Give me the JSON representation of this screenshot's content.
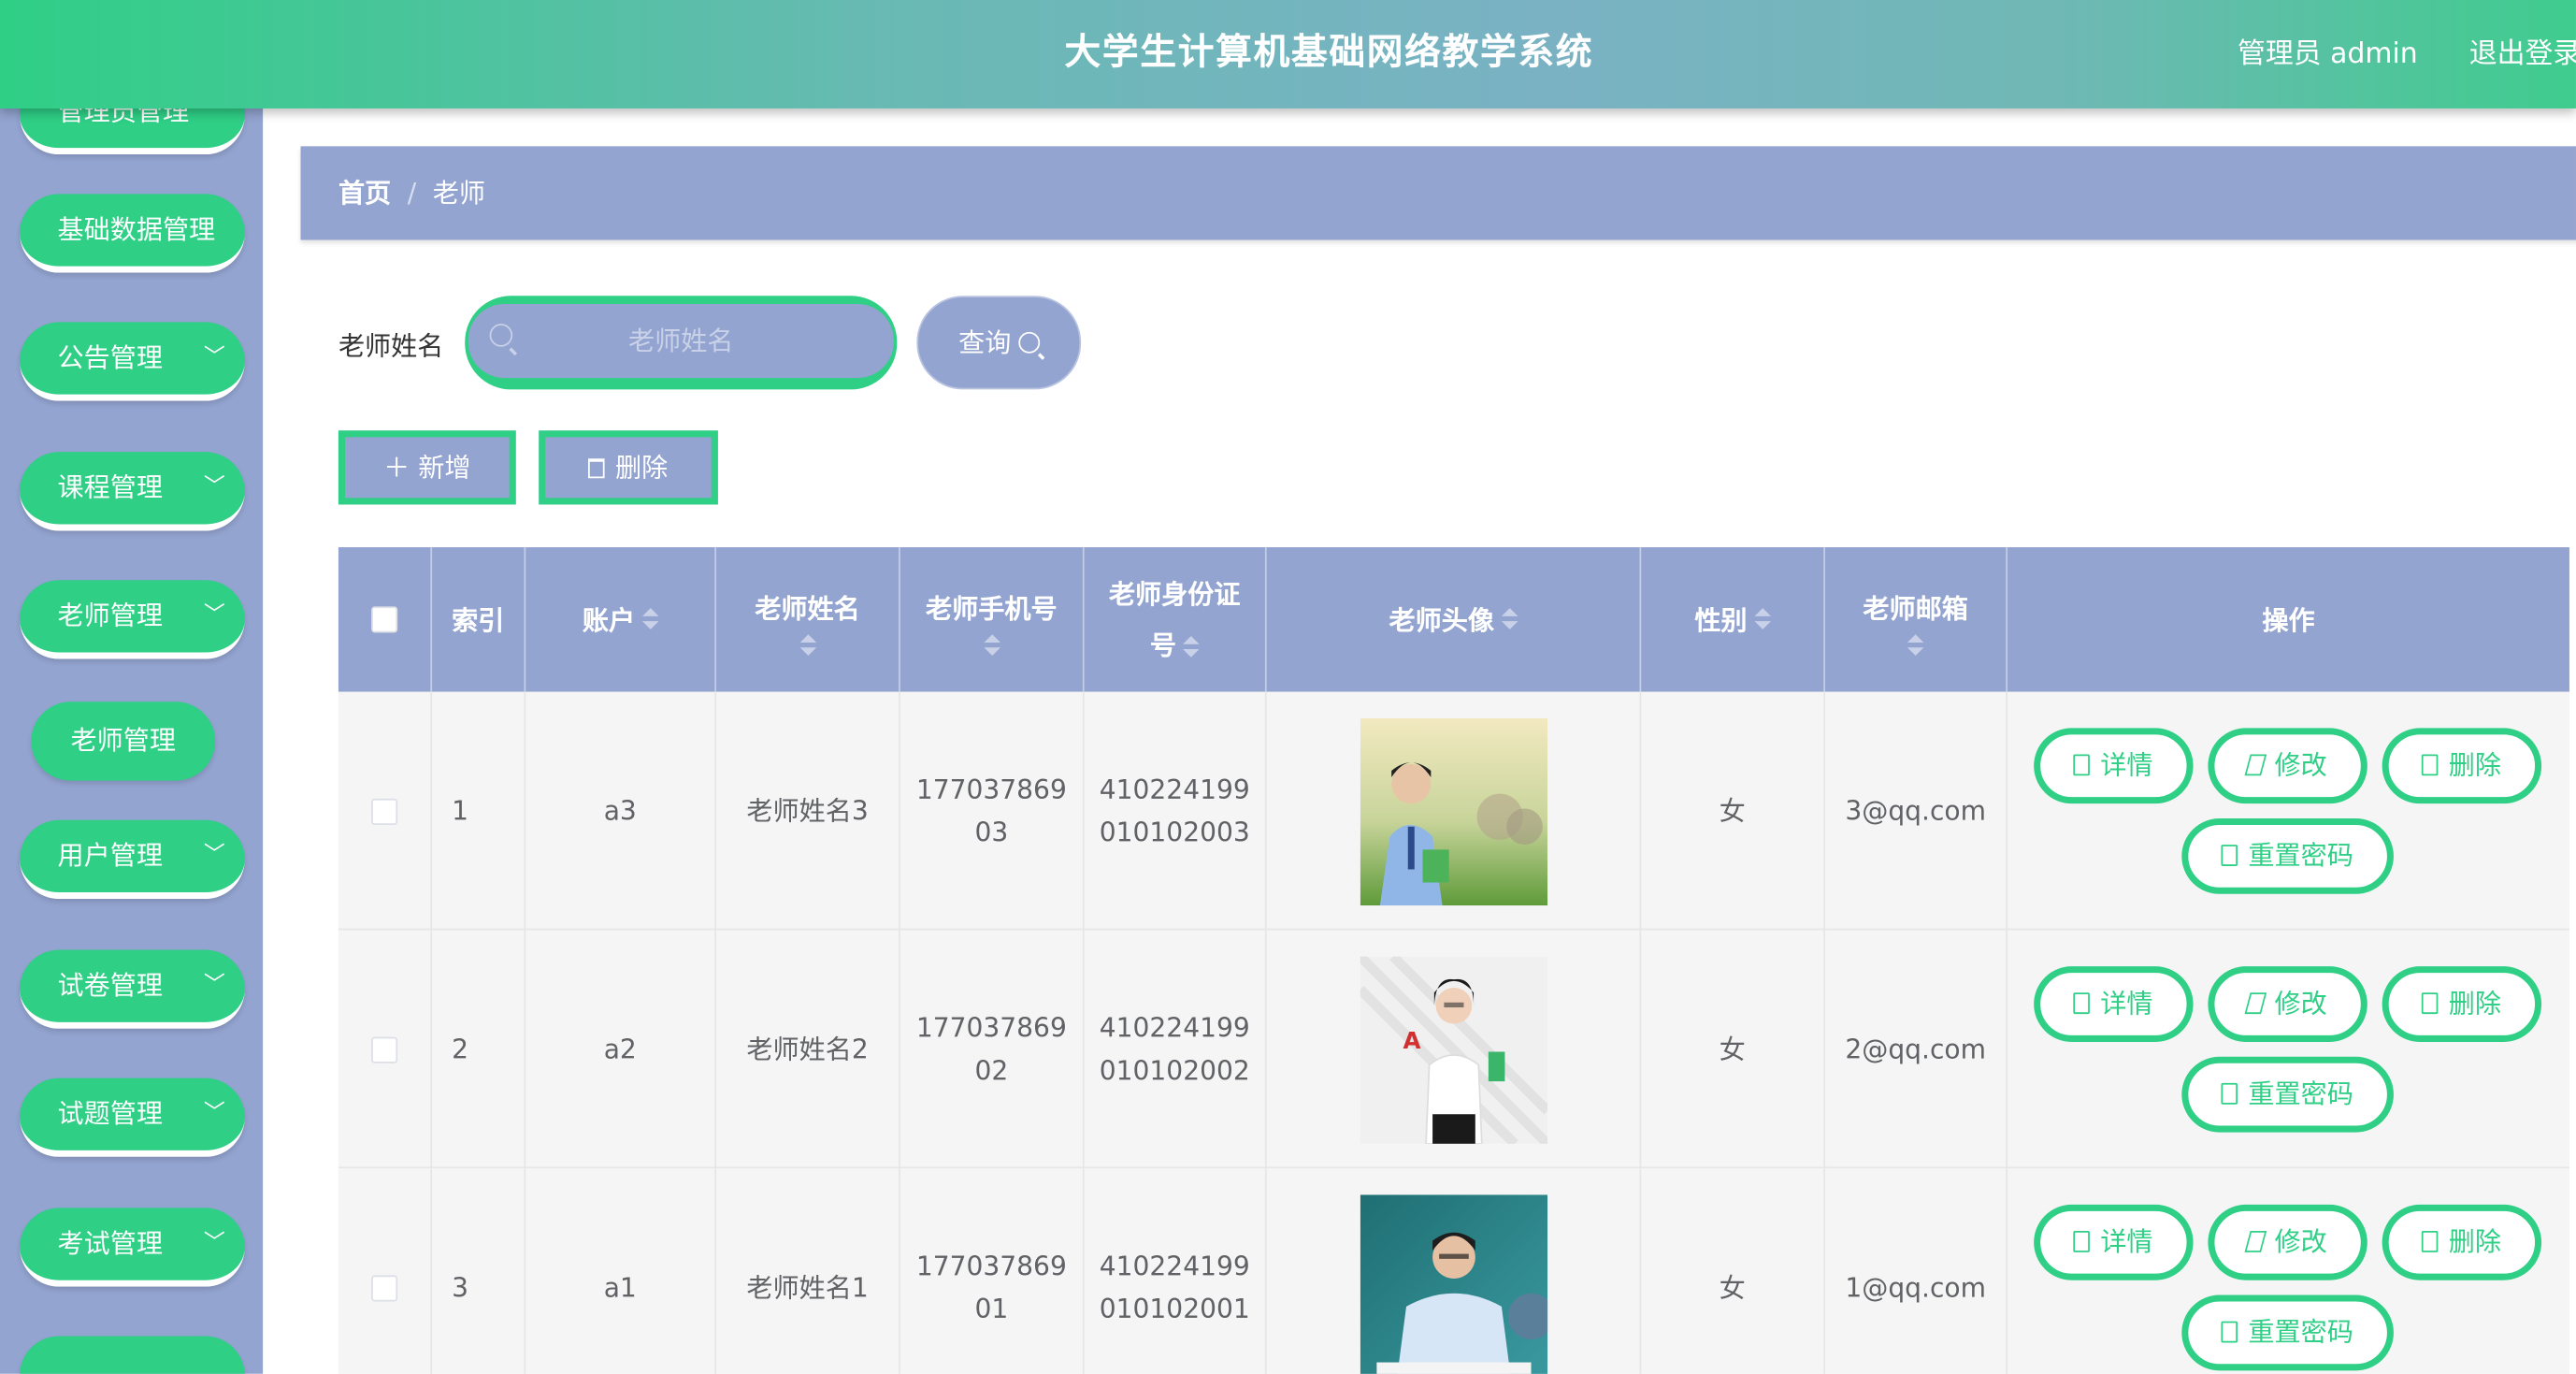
{
  "header": {
    "title": "大学生计算机基础网络教学系统",
    "admin": "管理员 admin",
    "logout": "退出登录"
  },
  "sidebar": {
    "items": [
      {
        "label": "管理员管理",
        "chevron": "﹀"
      },
      {
        "label": "基础数据管理",
        "chevron": ""
      },
      {
        "label": "公告管理",
        "chevron": "﹀"
      },
      {
        "label": "课程管理",
        "chevron": "﹀"
      },
      {
        "label": "老师管理",
        "chevron": "﹀"
      },
      {
        "label": "老师管理"
      },
      {
        "label": "用户管理",
        "chevron": "﹀"
      },
      {
        "label": "试卷管理",
        "chevron": "﹀"
      },
      {
        "label": "试题管理",
        "chevron": "﹀"
      },
      {
        "label": "考试管理",
        "chevron": "﹀"
      }
    ]
  },
  "breadcrumb": {
    "home": "首页",
    "sep": "/",
    "current": "老师"
  },
  "search": {
    "label": "老师姓名",
    "placeholder": "老师姓名",
    "button": "查询"
  },
  "actions": {
    "add": "＋ 新增",
    "delete": "删除"
  },
  "table": {
    "headers": [
      "索引",
      "账户",
      "老师姓名",
      "老师手机号",
      "老师身份证号",
      "老师头像",
      "性别",
      "老师邮箱",
      "操作"
    ],
    "headers_split": {
      "id_line1": "老师身份证",
      "id_line2": "号"
    },
    "rows": [
      {
        "index": "1",
        "account": "a3",
        "name": "老师姓名3",
        "phone1": "177037869",
        "phone2": "03",
        "id1": "410224199",
        "id2": "010102003",
        "gender": "女",
        "email": "3@qq.com"
      },
      {
        "index": "2",
        "account": "a2",
        "name": "老师姓名2",
        "phone1": "177037869",
        "phone2": "02",
        "id1": "410224199",
        "id2": "010102002",
        "gender": "女",
        "email": "2@qq.com"
      },
      {
        "index": "3",
        "account": "a1",
        "name": "老师姓名1",
        "phone1": "177037869",
        "phone2": "01",
        "id1": "410224199",
        "id2": "010102001",
        "gender": "女",
        "email": "1@qq.com"
      }
    ],
    "ops": {
      "detail": "详情",
      "edit": "修改",
      "delete": "删除",
      "reset": "重置密码"
    }
  },
  "colors": {
    "green": "#2fcf86",
    "lavender": "#93a4d0"
  }
}
